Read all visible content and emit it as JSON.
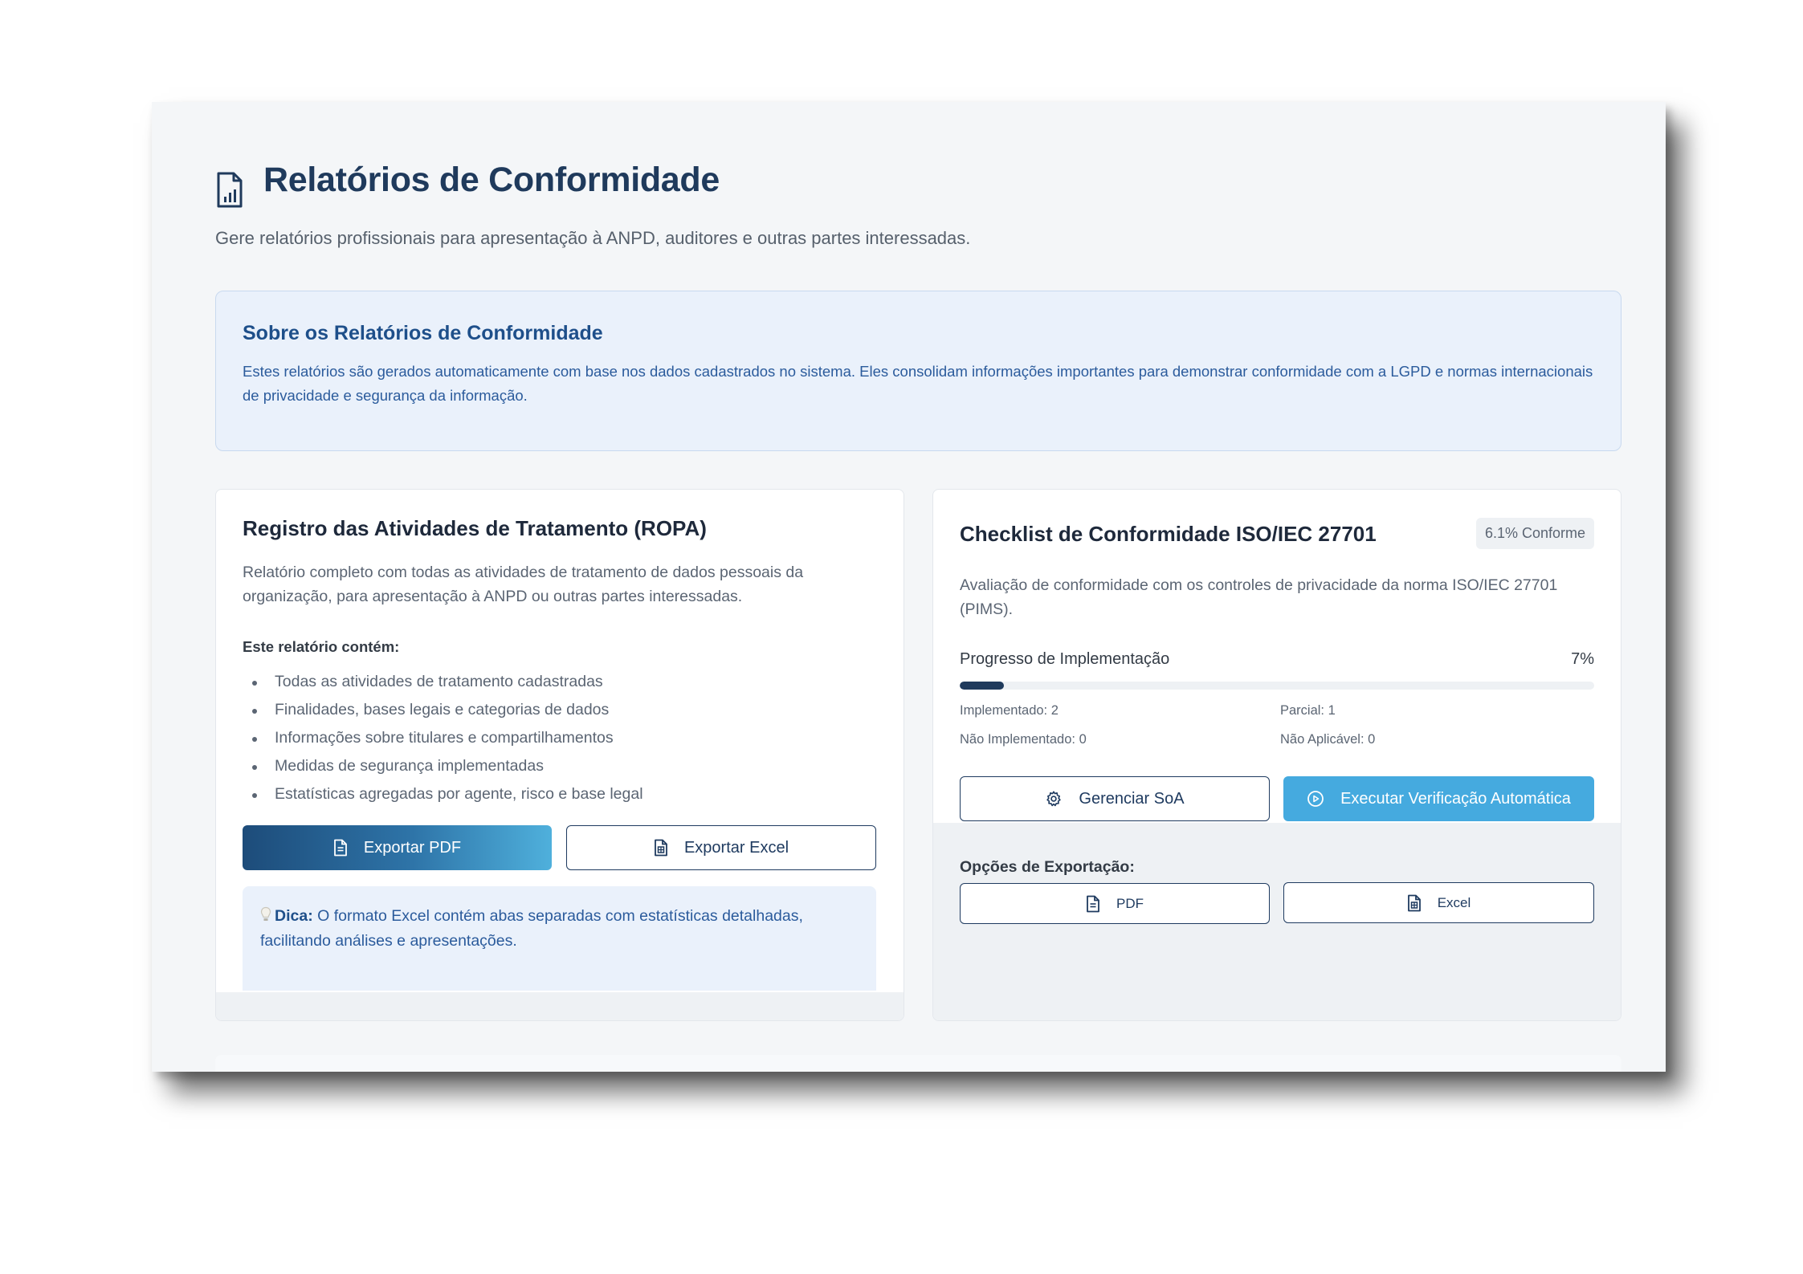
{
  "page": {
    "title": "Relatórios de Conformidade",
    "subtitle": "Gere relatórios profissionais para apresentação à ANPD, auditores e outras partes interessadas.",
    "icon": "report-chart-icon"
  },
  "info": {
    "title": "Sobre os Relatórios de Conformidade",
    "text": "Estes relatórios são gerados automaticamente com base nos dados cadastrados no sistema. Eles consolidam informações importantes para demonstrar conformidade com a LGPD e normas internacionais de privacidade e segurança da informação."
  },
  "ropa": {
    "title": "Registro das Atividades de Tratamento (ROPA)",
    "description": "Relatório completo com todas as atividades de tratamento de dados pessoais da organização, para apresentação à ANPD ou outras partes interessadas.",
    "contains_label": "Este relatório contém:",
    "items": [
      "Todas as atividades de tratamento cadastradas",
      "Finalidades, bases legais e categorias de dados",
      "Informações sobre titulares e compartilhamentos",
      "Medidas de segurança implementadas",
      "Estatísticas agregadas por agente, risco e base legal"
    ],
    "export_pdf": "Exportar PDF",
    "export_excel": "Exportar Excel",
    "tip_label": "Dica:",
    "tip_text": " O formato Excel contém abas separadas com estatísticas detalhadas, facilitando análises e apresentações."
  },
  "iso": {
    "title": "Checklist de Conformidade ISO/IEC 27701",
    "badge": "6.1% Conforme",
    "description": "Avaliação de conformidade com os controles de privacidade da norma ISO/IEC 27701 (PIMS).",
    "progress_label": "Progresso de Implementação",
    "progress_value": "7%",
    "progress_fraction": 0.07,
    "stats": {
      "implemented": "Implementado: 2",
      "partial": "Parcial: 1",
      "not_implemented": "Não Implementado: 0",
      "not_applicable": "Não Aplicável: 0"
    },
    "manage_soa": "Gerenciar SoA",
    "run_auto": "Executar Verificação Automática",
    "export_label": "Opções de Exportação:",
    "export_pdf": "PDF",
    "export_excel": "Excel"
  },
  "colors": {
    "title": "#1f3a5c",
    "info_bg": "#eaf1fb",
    "info_text": "#2b5b9c",
    "accent_button": "#45aadf",
    "progress_fill": "#1f3a5c"
  }
}
